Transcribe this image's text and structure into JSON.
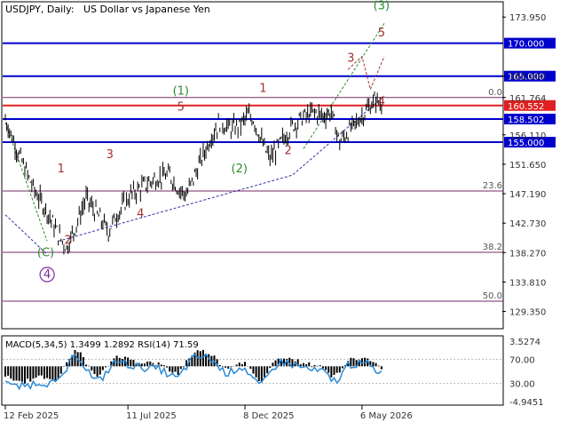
{
  "header": {
    "symbol": "USDJPY, Daily:",
    "description": "US Dollar vs Japanese Yen"
  },
  "chart_data": {
    "type": "line",
    "price_axis": {
      "ticks": [
        "173.950",
        "165.000",
        "161.764",
        "156.110",
        "151.650",
        "147.190",
        "142.730",
        "138.270",
        "133.810",
        "129.350"
      ],
      "ylim": [
        127.0,
        176.0
      ]
    },
    "x_axis": {
      "ticks": [
        "12 Feb 2025",
        "11 Jul 2025",
        "8 Dec 2025",
        "6 May 2026"
      ]
    },
    "price_series": {
      "anchors": [
        [
          0,
          158.5
        ],
        [
          10,
          153.0
        ],
        [
          20,
          148.0
        ],
        [
          30,
          144.5
        ],
        [
          38,
          141.0
        ],
        [
          44,
          139.0
        ],
        [
          50,
          142.0
        ],
        [
          58,
          146.5
        ],
        [
          66,
          144.0
        ],
        [
          74,
          141.5
        ],
        [
          80,
          144.0
        ],
        [
          90,
          147.0
        ],
        [
          100,
          148.5
        ],
        [
          108,
          149.5
        ],
        [
          118,
          150.0
        ],
        [
          124,
          148.0
        ],
        [
          130,
          147.0
        ],
        [
          140,
          152.0
        ],
        [
          148,
          156.0
        ],
        [
          154,
          158.0
        ],
        [
          162,
          157.0
        ],
        [
          168,
          157.5
        ],
        [
          174,
          159.0
        ],
        [
          178,
          158.5
        ],
        [
          186,
          154.0
        ],
        [
          190,
          152.5
        ],
        [
          198,
          155.0
        ],
        [
          206,
          157.5
        ],
        [
          214,
          158.8
        ],
        [
          222,
          159.5
        ],
        [
          228,
          159.0
        ],
        [
          234,
          159.5
        ],
        [
          240,
          155.0
        ],
        [
          244,
          156.0
        ],
        [
          252,
          158.0
        ],
        [
          260,
          160.0
        ],
        [
          266,
          161.5
        ],
        [
          270,
          160.5
        ]
      ],
      "current_price": "160.552"
    },
    "levels": [
      {
        "value": "170.000",
        "price": 170.0,
        "color": "#0000cc",
        "kind": "blue"
      },
      {
        "value": "165.000",
        "price": 165.0,
        "color": "#0000cc",
        "kind": "blue"
      },
      {
        "value": "158.502",
        "price": 158.502,
        "color": "#0000cc",
        "kind": "blue"
      },
      {
        "value": "155.000",
        "price": 155.0,
        "color": "#0000cc",
        "kind": "blue"
      },
      {
        "value": "160.552",
        "price": 160.552,
        "color": "#e02020",
        "kind": "red"
      }
    ],
    "fib_levels": [
      {
        "label": "0.0",
        "price": 161.764
      },
      {
        "label": "23.6",
        "price": 147.6
      },
      {
        "label": "38.2",
        "price": 138.3
      },
      {
        "label": "50.0",
        "price": 130.9
      }
    ],
    "wave_labels": [
      {
        "text": "(3)",
        "color": "#2e8b2e",
        "index": 270,
        "price": 175.1
      },
      {
        "text": "5",
        "color": "#a33030",
        "index": 270,
        "price": 171.0
      },
      {
        "text": "3",
        "color": "#a33030",
        "index": 248,
        "price": 167.2
      },
      {
        "text": "4",
        "color": "#a33030",
        "index": 270,
        "price": 160.6
      },
      {
        "text": "1",
        "color": "#a33030",
        "index": 185,
        "price": 162.6
      },
      {
        "text": "(1)",
        "color": "#2e8b2e",
        "index": 126,
        "price": 162.2
      },
      {
        "text": "5",
        "color": "#a33030",
        "index": 126,
        "price": 159.8
      },
      {
        "text": "2",
        "color": "#a33030",
        "index": 203,
        "price": 153.2
      },
      {
        "text": "(2)",
        "color": "#2e8b2e",
        "index": 168,
        "price": 150.4
      },
      {
        "text": "1",
        "color": "#a33030",
        "index": 40,
        "price": 150.4
      },
      {
        "text": "3",
        "color": "#a33030",
        "index": 75,
        "price": 152.6
      },
      {
        "text": "4",
        "color": "#a33030",
        "index": 97,
        "price": 143.6
      },
      {
        "text": "2",
        "color": "#a33030",
        "index": 45,
        "price": 139.6
      },
      {
        "text": "(C)",
        "color": "#2e8b2e",
        "index": 29,
        "price": 137.7
      },
      {
        "text": "4",
        "color": "#7a2aa0",
        "index": 30,
        "price": 134.4,
        "circled": true
      }
    ],
    "macd_panel": {
      "label": "MACD(5,34,5) 1.3499 1.2892 RSI(14) 71.59",
      "macd_main": 1.3499,
      "macd_signal": 1.2892,
      "rsi": 71.59,
      "ticks": [
        "3.5274",
        "70.00",
        "30.00",
        "-4.9451"
      ]
    }
  }
}
